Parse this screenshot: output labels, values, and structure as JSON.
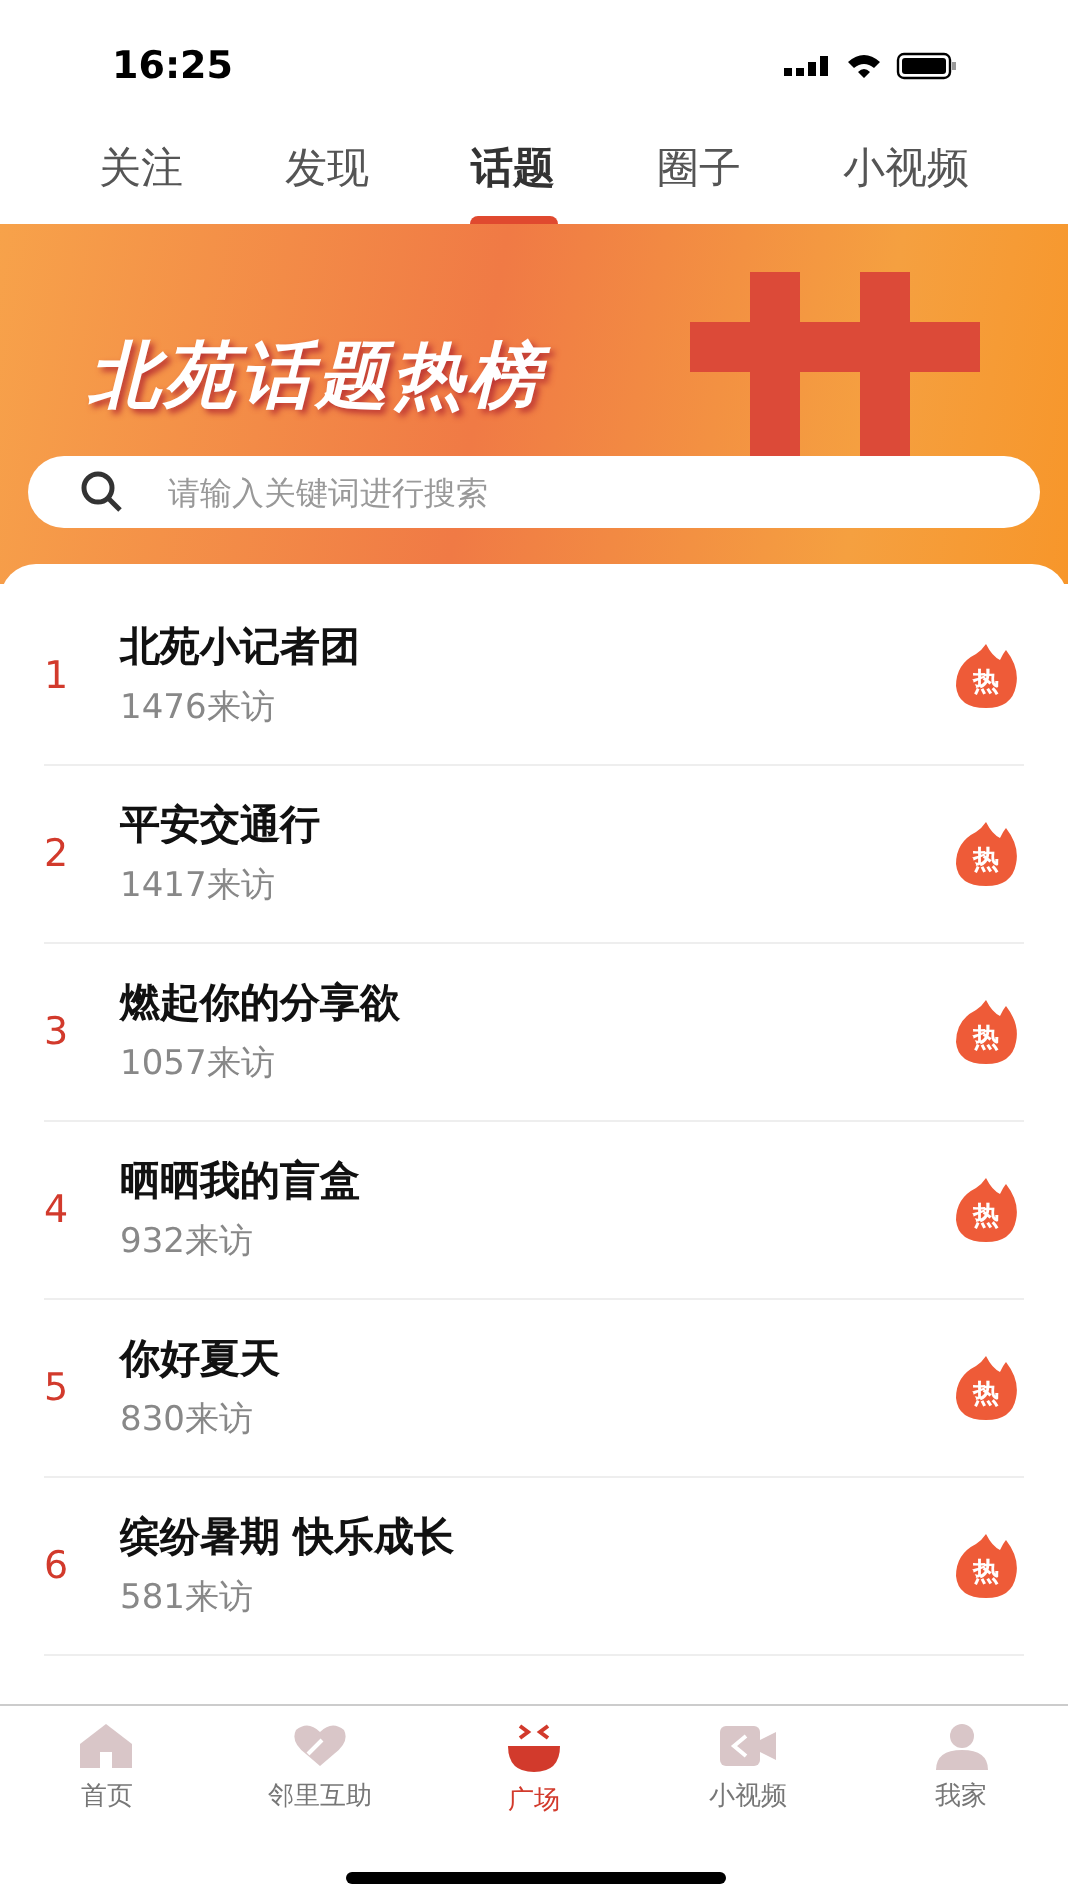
{
  "status_bar": {
    "time": "16:25"
  },
  "tabs": [
    {
      "label": "关注",
      "selected": false
    },
    {
      "label": "发现",
      "selected": false
    },
    {
      "label": "话题",
      "selected": true
    },
    {
      "label": "圈子",
      "selected": false
    },
    {
      "label": "小视频",
      "selected": false
    }
  ],
  "banner": {
    "title": "北苑话题热榜",
    "search": {
      "placeholder": "请输入关键词进行搜索"
    }
  },
  "topics": [
    {
      "rank": "1",
      "title": "北苑小记者团",
      "visits": "1476来访",
      "badge": "热"
    },
    {
      "rank": "2",
      "title": "平安交通行",
      "visits": "1417来访",
      "badge": "热"
    },
    {
      "rank": "3",
      "title": "燃起你的分享欲",
      "visits": "1057来访",
      "badge": "热"
    },
    {
      "rank": "4",
      "title": "晒晒我的盲盒",
      "visits": "932来访",
      "badge": "热"
    },
    {
      "rank": "5",
      "title": "你好夏天",
      "visits": "830来访",
      "badge": "热"
    },
    {
      "rank": "6",
      "title": "缤纷暑期 快乐成长",
      "visits": "581来访",
      "badge": "热"
    }
  ],
  "bottom_nav": [
    {
      "label": "首页",
      "selected": false
    },
    {
      "label": "邻里互助",
      "selected": false
    },
    {
      "label": "广场",
      "selected": true
    },
    {
      "label": "小视频",
      "selected": false
    },
    {
      "label": "我家",
      "selected": false
    }
  ]
}
